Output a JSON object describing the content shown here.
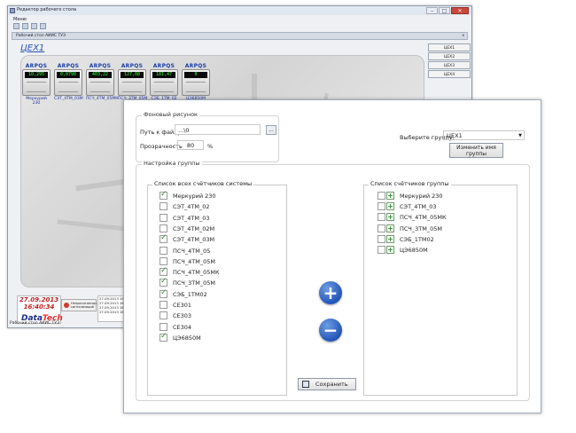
{
  "bg_window": {
    "title": "Редактор рабочего стола",
    "menu": "Меню",
    "tab_label": "Рабочий стол АИИС ТУЭ",
    "tab_close": "x",
    "group_link": "ЦЕХ1",
    "right_buttons": [
      "ЦЕХ1",
      "ЦЕХ2",
      "ЦЕХ3",
      "ЦЕХ4"
    ],
    "meters": [
      {
        "brand": "ARPQS",
        "display": "10,295",
        "name": "Меркурий 230"
      },
      {
        "brand": "ARPQS",
        "display": "0,0790",
        "name": "СЭТ_4ТМ_03М"
      },
      {
        "brand": "ARPQS",
        "display": "403,22",
        "name": "ПСЧ_4ТМ_05МК"
      },
      {
        "brand": "ARPQS",
        "display": "127,08",
        "name": "ПСЧ_3ТМ_05М"
      },
      {
        "brand": "ARPQS",
        "display": "181,47",
        "name": "СЭБ_1ТМ_02"
      },
      {
        "brand": "ARPQS",
        "display": "0",
        "name": "ЦЭ6850М"
      }
    ],
    "date": "27.09.2013",
    "time": "16:40:34",
    "logo_a": "Data",
    "logo_b": "Tech",
    "warn_button": "Непрочитанных сигнализаций",
    "log_lines": [
      "27.09.2013 16",
      "27.09.2013 16",
      "27.09.2013 16",
      "27.09.2013 16"
    ],
    "status": "Рабочий стол АИИС ТУЭ"
  },
  "dialog": {
    "bg_picture_legend": "Фоновый рисунок",
    "path_label": "Путь к файлу",
    "path_value": "...\\0",
    "browse_label": "...",
    "transparency_label": "Прозрачность",
    "transparency_value": "80",
    "transparency_unit": "%",
    "choose_group_label": "Выберите группу:",
    "group_value": "ЦЕХ1",
    "rename_button": "Изменить имя группы",
    "group_settings_legend": "Настройка группы",
    "all_meters_legend": "Список всех счётчиков системы",
    "all_meters": [
      {
        "label": "Меркурий 230",
        "checked": true
      },
      {
        "label": "СЭТ_4ТМ_02",
        "checked": false
      },
      {
        "label": "СЭТ_4ТМ_03",
        "checked": false
      },
      {
        "label": "СЭТ_4ТМ_02М",
        "checked": false
      },
      {
        "label": "СЭТ_4ТМ_03М",
        "checked": true
      },
      {
        "label": "ПСЧ_4ТМ_05",
        "checked": false
      },
      {
        "label": "ПСЧ_4ТМ_05М",
        "checked": false
      },
      {
        "label": "ПСЧ_4ТМ_05МК",
        "checked": true
      },
      {
        "label": "ПСЧ_3ТМ_05М",
        "checked": true
      },
      {
        "label": "СЭБ_1ТМ02",
        "checked": true
      },
      {
        "label": "СЕ301",
        "checked": false
      },
      {
        "label": "СЕ303",
        "checked": false
      },
      {
        "label": "СЕ304",
        "checked": false
      },
      {
        "label": "ЦЭ6850М",
        "checked": true
      }
    ],
    "group_meters_legend": "Список счётчиков группы",
    "group_meters": [
      "Меркурий 230",
      "СЭТ_4ТМ_03",
      "ПСЧ_4ТМ_05МК",
      "ПСЧ_3ТМ_05М",
      "СЭБ_1ТМ02",
      "ЦЭ6850М"
    ],
    "add_icon": "+",
    "remove_icon": "−",
    "save_button": "Сохранить"
  }
}
